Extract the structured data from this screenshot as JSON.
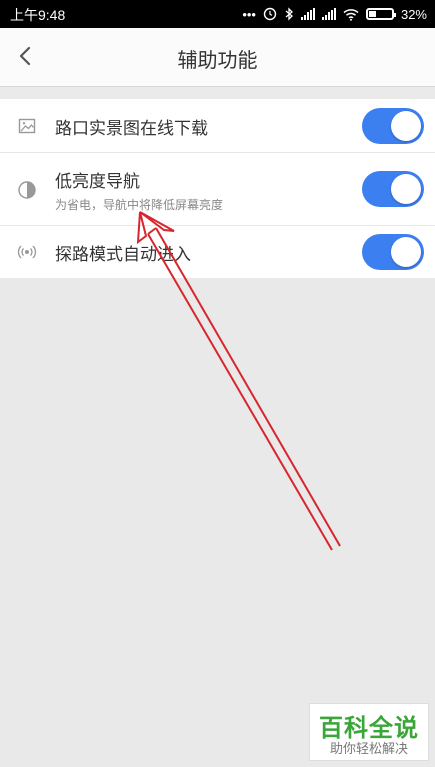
{
  "status_bar": {
    "time": "上午9:48",
    "battery_text": "32%",
    "battery_level": 0.32,
    "icons": [
      "more-dots-icon",
      "alarm-icon",
      "bluetooth-icon",
      "signal-icon",
      "signal-icon",
      "wifi-icon",
      "battery-icon"
    ]
  },
  "header": {
    "title": "辅助功能",
    "back_icon": "chevron-left-icon"
  },
  "settings": {
    "items": [
      {
        "title": "路口实景图在线下载",
        "subtitle": "",
        "icon": "image-icon",
        "enabled": true
      },
      {
        "title": "低亮度导航",
        "subtitle": "为省电，导航中将降低屏幕亮度",
        "icon": "contrast-icon",
        "enabled": true
      },
      {
        "title": "探路模式自动进入",
        "subtitle": "",
        "icon": "broadcast-icon",
        "enabled": true
      }
    ]
  },
  "colors": {
    "toggle_on": "#3c7ff0",
    "annotation_arrow": "#d7262e",
    "watermark_green": "#3aa63a"
  },
  "watermark": {
    "main": "百科全说",
    "sub": "助你轻松解决"
  }
}
